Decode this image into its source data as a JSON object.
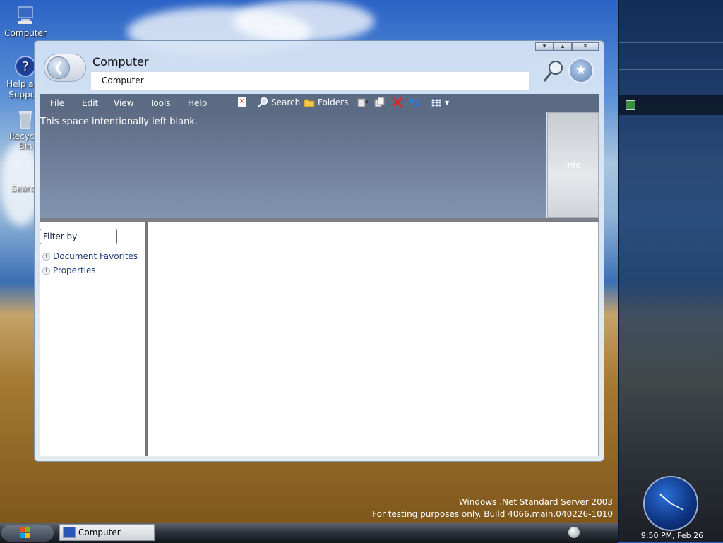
{
  "desktop": {
    "icons": [
      {
        "label": "Computer"
      },
      {
        "label": "Help and Support"
      },
      {
        "label": "Recycle Bin"
      },
      {
        "label": "Search"
      }
    ],
    "watermark_line1": "Windows .Net Standard Server 2003",
    "watermark_line2": "For testing purposes only. Build 4066.main.040226-1010"
  },
  "taskbar": {
    "task_label": "Computer"
  },
  "sidebar": {
    "clock_text": "9:50 PM, Feb 26"
  },
  "window": {
    "title": "Computer",
    "address": "Computer",
    "controls": {
      "minimize": "▾",
      "maximize": "▴",
      "close": "✕"
    }
  },
  "menu": {
    "file": "File",
    "edit": "Edit",
    "view": "View",
    "tools": "Tools",
    "help": "Help"
  },
  "toolbar": {
    "search_label": "Search",
    "folders_label": "Folders"
  },
  "content": {
    "blank_text": "This space intentionally left blank.",
    "info_label": "info"
  },
  "left_pane": {
    "filter_value": "Filter by",
    "tree": [
      {
        "label": "Document Favorites"
      },
      {
        "label": "Properties"
      }
    ]
  },
  "colors": {
    "toolbar_bg": "#5c6b84",
    "tree_link": "#1c3c78"
  }
}
